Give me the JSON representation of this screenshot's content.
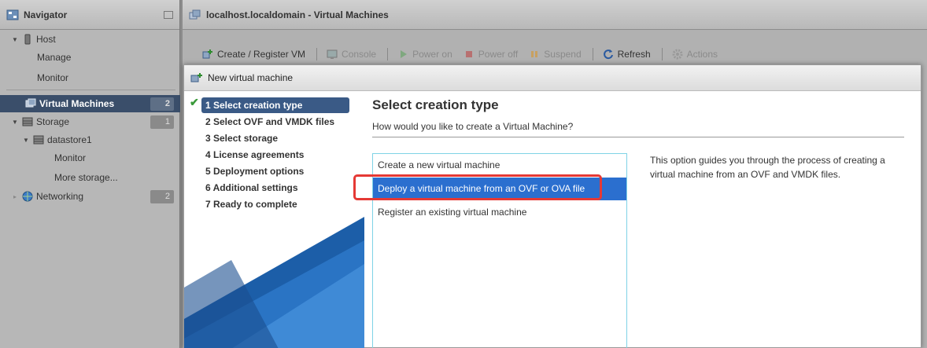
{
  "navigator": {
    "title": "Navigator",
    "items": [
      {
        "label": "Host",
        "badge": ""
      },
      {
        "label": "Manage",
        "badge": ""
      },
      {
        "label": "Monitor",
        "badge": ""
      },
      {
        "label": "Virtual Machines",
        "badge": "2"
      },
      {
        "label": "Storage",
        "badge": "1"
      },
      {
        "label": "datastore1",
        "badge": ""
      },
      {
        "label": "Monitor",
        "badge": ""
      },
      {
        "label": "More storage...",
        "badge": ""
      },
      {
        "label": "Networking",
        "badge": "2"
      }
    ]
  },
  "main": {
    "title": "localhost.localdomain - Virtual Machines",
    "toolbar": {
      "create": "Create / Register VM",
      "console": "Console",
      "power_on": "Power on",
      "power_off": "Power off",
      "suspend": "Suspend",
      "refresh": "Refresh",
      "actions": "Actions"
    }
  },
  "dialog": {
    "title": "New virtual machine",
    "steps": [
      "1 Select creation type",
      "2 Select OVF and VMDK files",
      "3 Select storage",
      "4 License agreements",
      "5 Deployment options",
      "6 Additional settings",
      "7 Ready to complete"
    ],
    "heading": "Select creation type",
    "subheading": "How would you like to create a Virtual Machine?",
    "options": [
      "Create a new virtual machine",
      "Deploy a virtual machine from an OVF or OVA file",
      "Register an existing virtual machine"
    ],
    "description": "This option guides you through the process of creating a virtual machine from an OVF and VMDK files."
  },
  "colors": {
    "selected_option": "#2b6fcf",
    "highlight_box": "#e53935",
    "current_step": "#3a5a86"
  }
}
